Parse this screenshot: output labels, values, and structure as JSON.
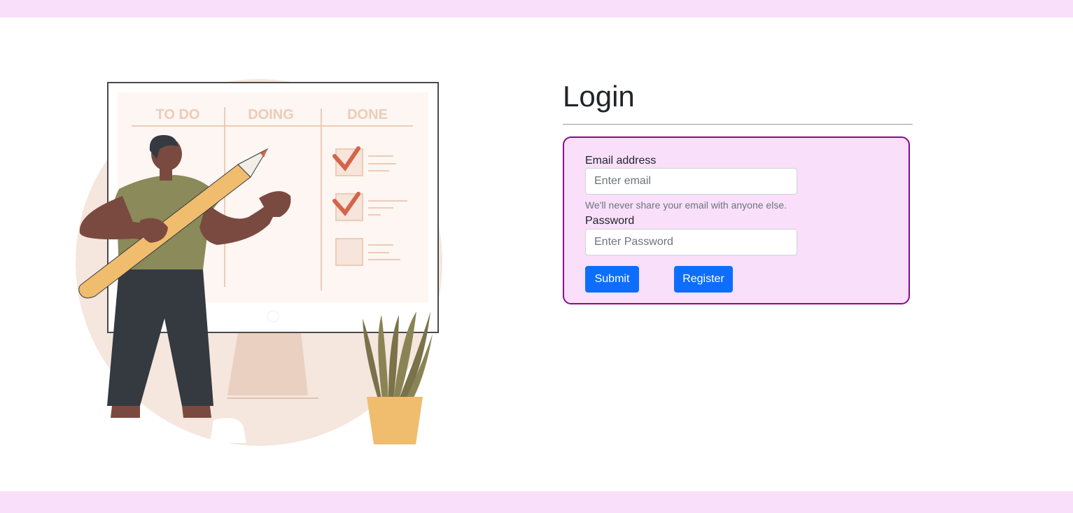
{
  "header": {
    "title": "Login"
  },
  "illustration": {
    "board_columns": [
      "TO DO",
      "DOING",
      "DONE"
    ]
  },
  "form": {
    "email": {
      "label": "Email address",
      "placeholder": "Enter email",
      "value": "",
      "help_text": "We'll never share your email with anyone else."
    },
    "password": {
      "label": "Password",
      "placeholder": "Enter Password",
      "value": ""
    },
    "submit_label": "Submit",
    "register_label": "Register"
  },
  "colors": {
    "bar_background": "#f9dffa",
    "card_border": "#8b0a8b",
    "button_primary": "#0d6efd"
  }
}
